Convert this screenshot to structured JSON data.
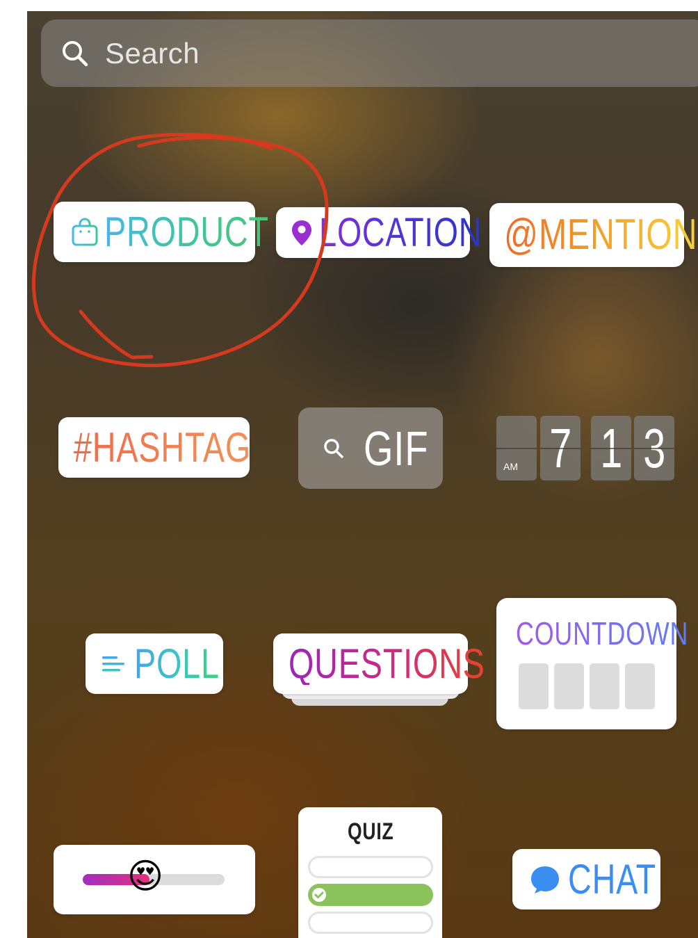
{
  "search": {
    "placeholder": "Search"
  },
  "stickers": {
    "product": {
      "label": "PRODUCT"
    },
    "location": {
      "label": "LOCATION"
    },
    "mention": {
      "label": "@MENTION"
    },
    "hashtag": {
      "label": "#HASHTAG"
    },
    "gif": {
      "label": "GIF"
    },
    "time": {
      "ampm": "AM",
      "hour": "7",
      "minute_tens": "1",
      "minute_ones": "3"
    },
    "poll": {
      "label": "POLL"
    },
    "questions": {
      "label": "QUESTIONS"
    },
    "countdown": {
      "label": "COUNTDOWN"
    },
    "emoji_slider": {
      "emoji": "😍",
      "level": 0.45
    },
    "quiz": {
      "label": "QUIZ"
    },
    "chat": {
      "label": "CHAT"
    }
  },
  "colors": {
    "annotation_circle": "#d63a1e",
    "quiz_correct": "#8cc25c",
    "chat_bubble": "#3a8ef0"
  },
  "icons": {
    "search": "search-icon",
    "product": "shopping-bag-icon",
    "location": "map-pin-icon",
    "gif": "search-icon",
    "poll": "poll-lines-icon",
    "chat": "chat-bubble-icon",
    "quiz_check": "checkmark-icon"
  }
}
